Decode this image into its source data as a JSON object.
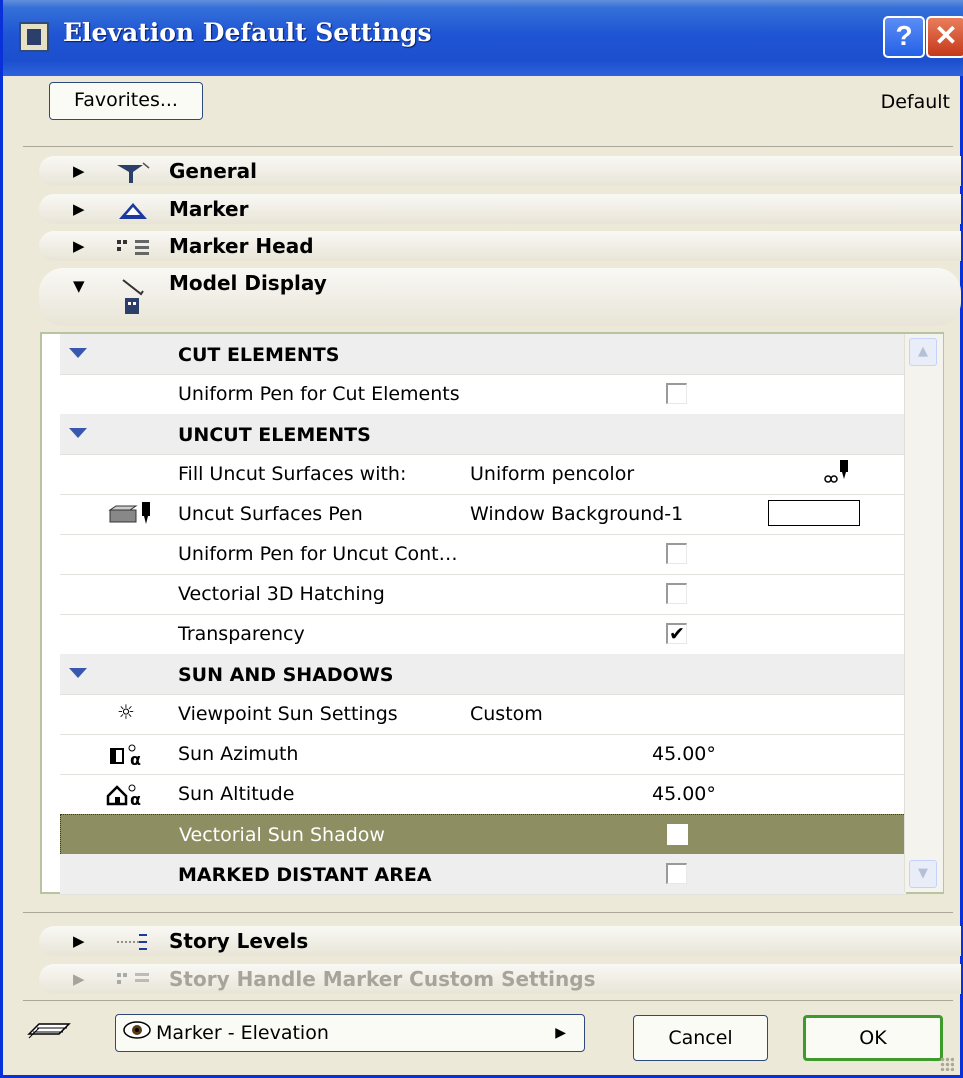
{
  "window": {
    "title": "Elevation Default Settings",
    "help_label": "?",
    "close_label": "✕"
  },
  "toolbar": {
    "favorites_label": "Favorites...",
    "default_label": "Default"
  },
  "sections": {
    "general": "General",
    "marker": "Marker",
    "marker_head": "Marker Head",
    "model_display": "Model Display",
    "story_levels": "Story Levels",
    "story_handle": "Story Handle Marker Custom Settings"
  },
  "panel": {
    "cut_elements": "CUT ELEMENTS",
    "uniform_pen_cut": "Uniform Pen for Cut Elements",
    "uncut_elements": "UNCUT ELEMENTS",
    "fill_uncut": "Fill Uncut Surfaces with:",
    "fill_uncut_value": "Uniform pencolor",
    "uncut_pen": "Uncut Surfaces Pen",
    "uncut_pen_value": "Window Background-1",
    "uniform_pen_uncut": "Uniform Pen for Uncut Cont…",
    "vectorial_hatching": "Vectorial 3D Hatching",
    "transparency": "Transparency",
    "sun_shadows": "SUN AND SHADOWS",
    "viewpoint_sun": "Viewpoint Sun Settings",
    "viewpoint_sun_value": "Custom",
    "sun_azimuth": "Sun Azimuth",
    "sun_azimuth_value": "45.00°",
    "sun_altitude": "Sun Altitude",
    "sun_altitude_value": "45.00°",
    "vectorial_sun_shadow": "Vectorial Sun Shadow",
    "marked_distant": "MARKED DISTANT AREA",
    "checkboxes": {
      "uniform_pen_cut": false,
      "uniform_pen_uncut": false,
      "vectorial_hatching": false,
      "transparency": true,
      "vectorial_sun_shadow": false,
      "marked_distant": false
    },
    "check_mark": "✔"
  },
  "footer": {
    "layer_dropdown": "Marker - Elevation",
    "cancel_label": "Cancel",
    "ok_label": "OK"
  },
  "colors": {
    "title_bar": "#1f55d4",
    "selected_row": "#8d8f63",
    "group_row": "#eeeeef",
    "ok_border": "#3d9a2b"
  }
}
